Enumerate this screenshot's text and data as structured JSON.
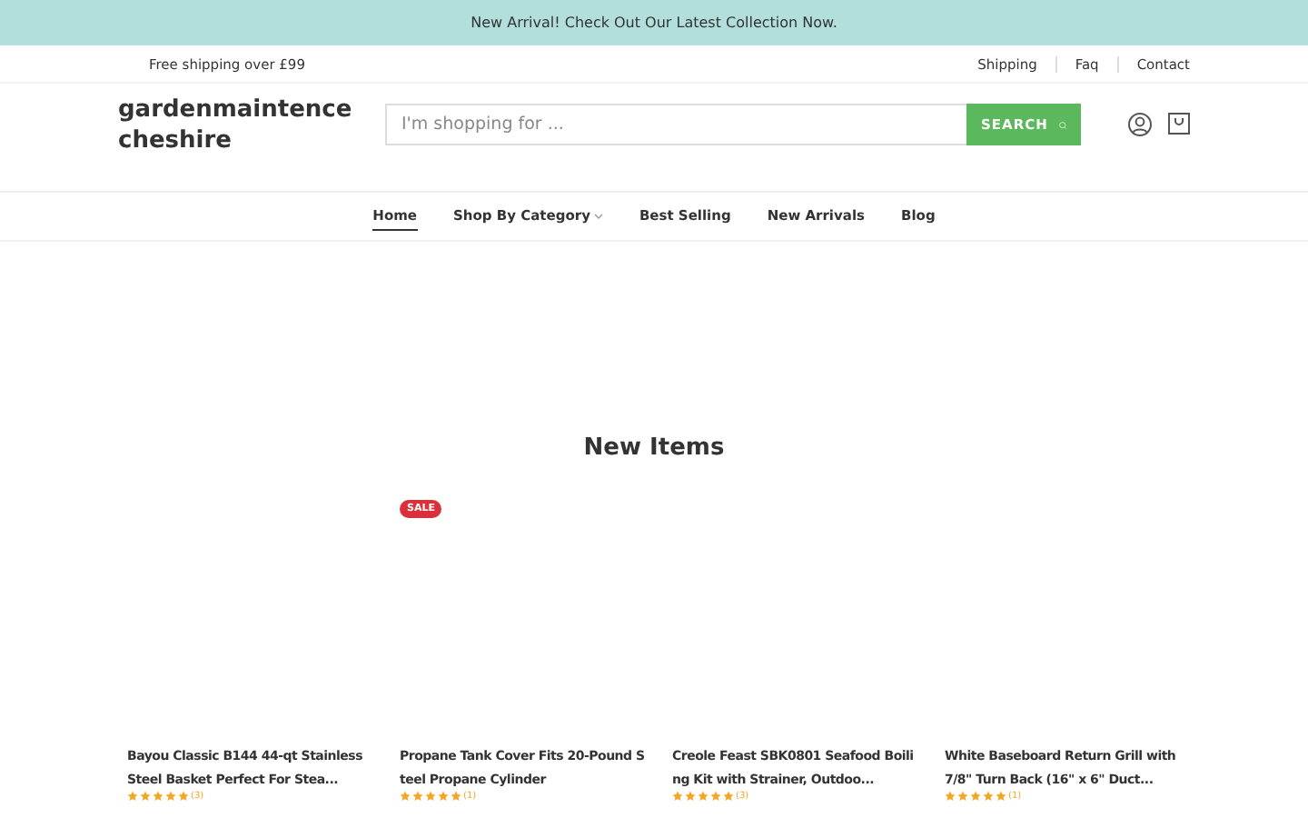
{
  "announcement": "New Arrival! Check Out Our Latest Collection Now.",
  "top_bar": {
    "shipping_note": "Free shipping over £99",
    "links": [
      "Shipping",
      "Faq",
      "Contact"
    ]
  },
  "header": {
    "logo": "gardenmaintencecheshire",
    "search": {
      "placeholder": "I'm shopping for ...",
      "button": "SEARCH"
    }
  },
  "nav": [
    {
      "label": "Home",
      "selected": true,
      "dropdown": false
    },
    {
      "label": "Shop By Category",
      "selected": false,
      "dropdown": true
    },
    {
      "label": "Best Selling",
      "selected": false,
      "dropdown": false
    },
    {
      "label": "New Arrivals",
      "selected": false,
      "dropdown": false
    },
    {
      "label": "Blog",
      "selected": false,
      "dropdown": false
    }
  ],
  "section_title": "New Items",
  "products": [
    {
      "title": "Bayou Classic B144 44-qt Stainless Steel Basket Perfect For Stea...",
      "sale": false,
      "stars": 5,
      "reviews": "(3)"
    },
    {
      "title": "Propane Tank Cover Fits 20-Pound Steel Propane Cylinder",
      "sale": true,
      "badge": "SALE",
      "stars": 5,
      "reviews": "(1)"
    },
    {
      "title": "Creole Feast SBK0801 Seafood Boiling Kit with Strainer, Outdoo...",
      "sale": false,
      "stars": 5,
      "reviews": "(3)"
    },
    {
      "title": "White Baseboard Return Grill with 7/8\" Turn Back (16\" x 6\" Duct...",
      "sale": false,
      "stars": 5,
      "reviews": "(1)"
    }
  ]
}
